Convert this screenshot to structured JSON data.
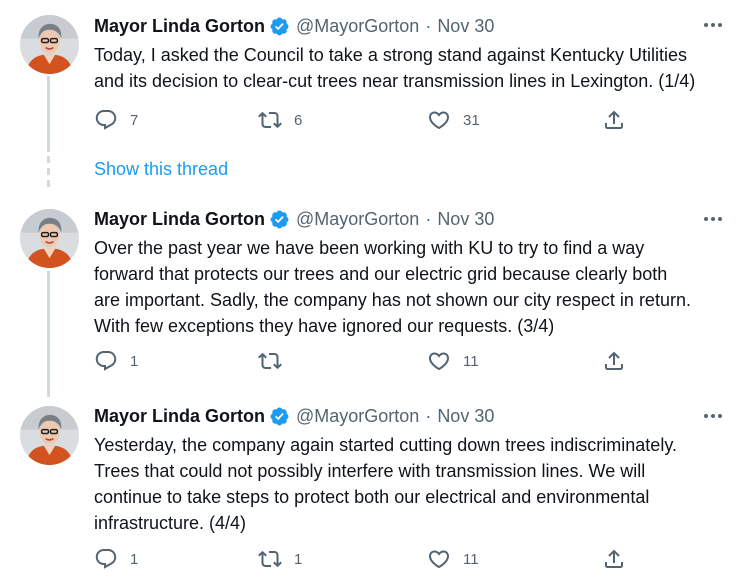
{
  "colors": {
    "accent": "#1d9bf0",
    "text": "#0f1419",
    "muted": "#536471",
    "line": "#cfd9de"
  },
  "show_thread": "Show this thread",
  "tweets": [
    {
      "name": "Mayor Linda Gorton",
      "handle": "@MayorGorton",
      "sep": "·",
      "date": "Nov 30",
      "lines": [
        "Today, I asked the Council to take a strong stand against Kentucky Utilities",
        "and its decision to clear-cut trees near transmission lines in Lexington. (1/4)"
      ],
      "replies": "7",
      "retweets": "6",
      "likes": "31"
    },
    {
      "name": "Mayor Linda Gorton",
      "handle": "@MayorGorton",
      "sep": "·",
      "date": "Nov 30",
      "lines": [
        "Over the past year we have been working with KU to try to find a way",
        "forward that protects our trees and our electric grid because clearly both",
        "are important. Sadly, the company has not shown our city respect in return.",
        "With few exceptions they have ignored our requests. (3/4)"
      ],
      "replies": "1",
      "retweets": "",
      "likes": "11"
    },
    {
      "name": "Mayor Linda Gorton",
      "handle": "@MayorGorton",
      "sep": "·",
      "date": "Nov 30",
      "lines": [
        "Yesterday, the company again started cutting down trees indiscriminately.",
        "Trees that could not possibly interfere with transmission lines. We will",
        "continue to take steps to protect both our electrical and environmental",
        "infrastructure. (4/4)"
      ],
      "replies": "1",
      "retweets": "1",
      "likes": "11"
    }
  ]
}
